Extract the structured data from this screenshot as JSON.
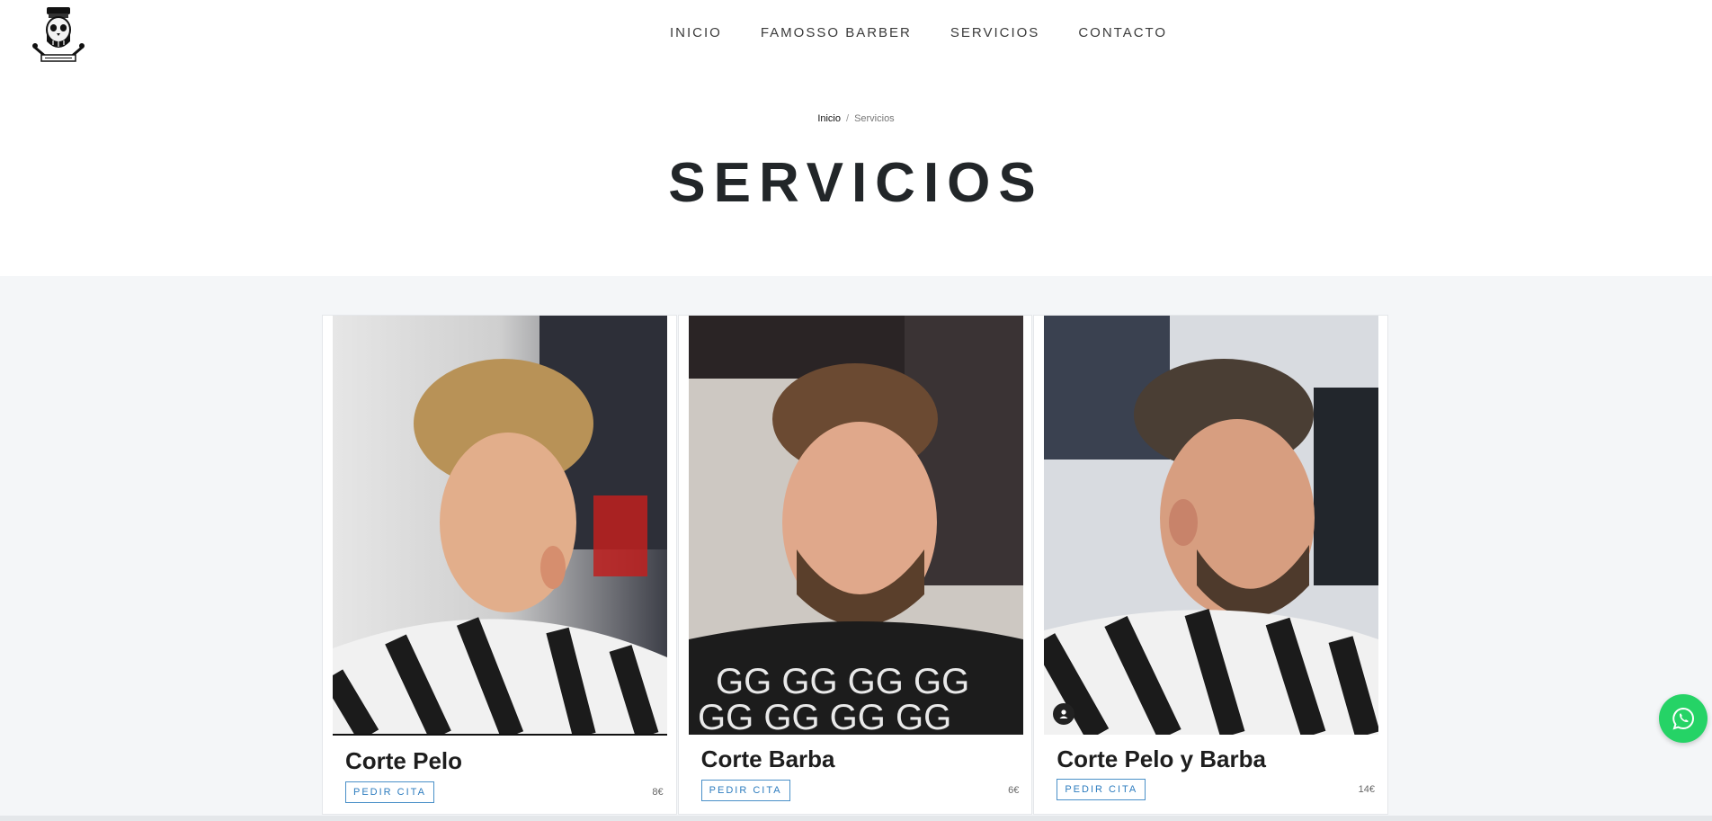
{
  "nav": {
    "items": [
      "INICIO",
      "FAMOSSO BARBER",
      "SERVICIOS",
      "CONTACTO"
    ]
  },
  "breadcrumb": {
    "home": "Inicio",
    "separator": "/",
    "current": "Servicios"
  },
  "page": {
    "title": "SERVICIOS"
  },
  "services": [
    {
      "name": "Corte Pelo",
      "button": "PEDIR CITA",
      "price": "8€"
    },
    {
      "name": "Corte Barba",
      "button": "PEDIR CITA",
      "price": "6€"
    },
    {
      "name": "Corte Pelo y Barba",
      "button": "PEDIR CITA",
      "price": "14€"
    }
  ],
  "colors": {
    "accent_blue": "#2d7cbf",
    "whatsapp_green": "#25d366",
    "section_bg": "#f4f6f8",
    "title": "#222629"
  }
}
